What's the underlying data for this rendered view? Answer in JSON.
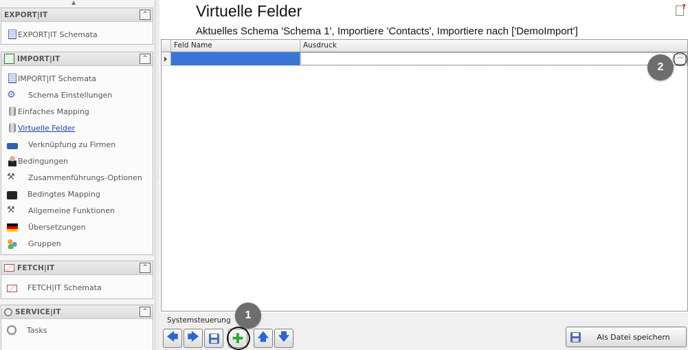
{
  "sidebar": {
    "groups": [
      {
        "title": "EXPORT|IT",
        "collapse": "^",
        "items": [
          {
            "label": "EXPORT|IT Schemata",
            "icon": "schema-list-icon"
          }
        ]
      },
      {
        "title": "IMPORT|IT",
        "collapse": "^",
        "items": [
          {
            "label": "IMPORT|IT Schemata",
            "icon": "schema-list-icon"
          },
          {
            "label": "Schema Einstellungen",
            "icon": "gears-icon"
          },
          {
            "label": "Einfaches Mapping",
            "icon": "cylinder-icon"
          },
          {
            "label": "Virtuelle Felder",
            "icon": "cylinder-icon",
            "active": true
          },
          {
            "label": "Verknüpfung zu Firmen",
            "icon": "truck-icon"
          },
          {
            "label": "Bedingungen",
            "icon": "person-icon"
          },
          {
            "label": "Zusammenführungs-Optionen",
            "icon": "tools-icon"
          },
          {
            "label": "Bedingtes Mapping",
            "icon": "briefcase-icon"
          },
          {
            "label": "Allgemeine Funktionen",
            "icon": "tools-icon"
          },
          {
            "label": "Übersetzungen",
            "icon": "flags-icon"
          },
          {
            "label": "Gruppen",
            "icon": "users-icon"
          }
        ]
      },
      {
        "title": "FETCH|IT",
        "collapse": "^",
        "items": [
          {
            "label": "FETCH|IT Schemata",
            "icon": "mail-icon"
          }
        ]
      },
      {
        "title": "SERVICE|IT",
        "collapse": "^",
        "items": [
          {
            "label": "Tasks",
            "icon": "clock-icon"
          }
        ]
      }
    ]
  },
  "main": {
    "title": "Virtuelle Felder",
    "subtitle": "Aktuelles Schema 'Schema 1', Importiere 'Contacts', Importiere nach ['DemoImport']",
    "grid": {
      "columns": [
        "Feld Name",
        "Ausdruck"
      ],
      "rows": [
        {
          "feld_name": "",
          "ausdruck": ""
        }
      ],
      "ellipsis": "···"
    },
    "callouts": {
      "one": "1",
      "two": "2"
    },
    "toolbar": {
      "label": "Systemsteuerung",
      "back": "🡄",
      "forward": "🡆",
      "add": "✚",
      "up": "🡅",
      "down": "🡇",
      "save_file": "Als Datei speichern"
    }
  },
  "colors": {
    "selection": "#3875d7",
    "callout": "#6e6e6e",
    "link": "#1a3fb5"
  }
}
